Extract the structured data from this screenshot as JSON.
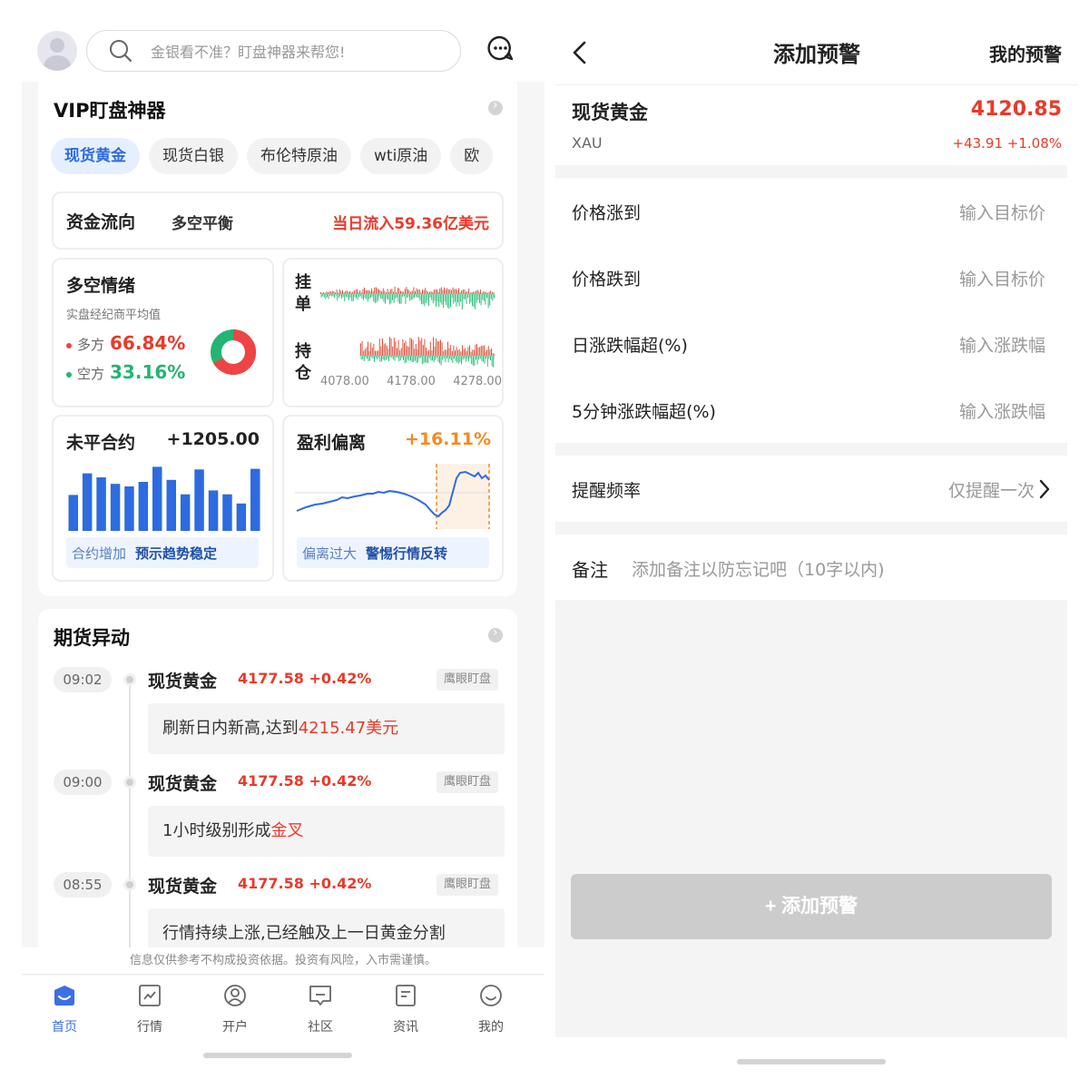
{
  "left": {
    "search": {
      "placeholder": "金银看不准？盯盘神器来帮您!"
    },
    "vip": {
      "title": "VIP盯盘神器",
      "tabs": [
        "现货黄金",
        "现货白银",
        "布伦特原油",
        "wti原油",
        "欧"
      ],
      "flow": {
        "label": "资金流向",
        "status": "多空平衡",
        "inflow": "当日流入59.36亿美元"
      },
      "sentiment": {
        "title": "多空情绪",
        "subtitle": "实盘经纪商平均值",
        "long_label": "多方",
        "long_value": "66.84%",
        "short_label": "空方",
        "short_value": "33.16%",
        "long_fraction": 0.6684,
        "colors": {
          "long": "#ef4444",
          "short": "#22b573"
        }
      },
      "orders": {
        "label_top": "挂单",
        "label_bottom": "持仓",
        "ticks": [
          "4078.00",
          "4178.00",
          "4278.00"
        ]
      },
      "open_interest": {
        "title": "未平合约",
        "value": "+1205.00",
        "bars": [
          0.55,
          0.88,
          0.82,
          0.72,
          0.68,
          0.75,
          0.98,
          0.78,
          0.56,
          0.94,
          0.62,
          0.56,
          0.42,
          0.95
        ],
        "foot_a": "合约增加",
        "foot_b": "预示趋势稳定"
      },
      "deviation": {
        "title": "盈利偏离",
        "value": "+16.11%",
        "foot_a": "偏离过大",
        "foot_b": "警惕行情反转"
      }
    },
    "futures": {
      "title": "期货异动",
      "events": [
        {
          "time": "09:02",
          "name": "现货黄金",
          "quote": "4177.58 +0.42%",
          "tag": "鹰眼盯盘",
          "msg": "刷新日内新高,达到",
          "msg_hl": "4215.47美元"
        },
        {
          "time": "09:00",
          "name": "现货黄金",
          "quote": "4177.58 +0.42%",
          "tag": "鹰眼盯盘",
          "msg": "1小时级别形成",
          "msg_hl": "金叉"
        },
        {
          "time": "08:55",
          "name": "现货黄金",
          "quote": "4177.58 +0.42%",
          "tag": "鹰眼盯盘",
          "msg": "行情持续上涨,已经触及上一日黄金分割",
          "msg_hl": ""
        }
      ]
    },
    "disclaimer": "信息仅供参考不构成投资依据。投资有风险，入市需谨慎。",
    "tabbar": [
      "首页",
      "行情",
      "开户",
      "社区",
      "资讯",
      "我的"
    ]
  },
  "right": {
    "title": "添加预警",
    "link": "我的预警",
    "quote": {
      "name": "现货黄金",
      "code": "XAU",
      "price": "4120.85",
      "change": "+43.91 +1.08%"
    },
    "fields": [
      {
        "label": "价格涨到",
        "placeholder": "输入目标价"
      },
      {
        "label": "价格跌到",
        "placeholder": "输入目标价"
      },
      {
        "label": "日涨跌幅超(%)",
        "placeholder": "输入涨跌幅"
      },
      {
        "label": "5分钟涨跌幅超(%)",
        "placeholder": "输入涨跌幅"
      }
    ],
    "frequency": {
      "label": "提醒频率",
      "value": "仅提醒一次"
    },
    "note": {
      "label": "备注",
      "placeholder": "添加备注以防忘记吧（10字以内)"
    },
    "button": "+ 添加预警"
  }
}
